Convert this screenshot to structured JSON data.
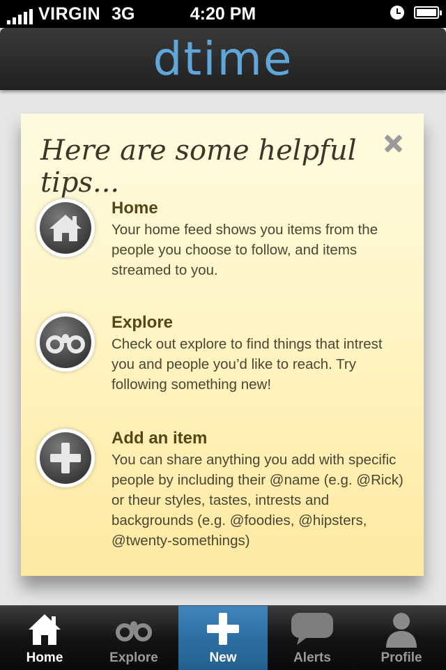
{
  "status_bar": {
    "carrier": "VIRGIN",
    "network": "3G",
    "time": "4:20 PM"
  },
  "nav": {
    "logo": "dtime"
  },
  "tips_card": {
    "title": "Here are some helpful tips...",
    "tips": [
      {
        "icon": "home-icon",
        "heading": "Home",
        "body": "Your home feed shows you items from the people you choose to follow, and items streamed to you."
      },
      {
        "icon": "binoculars-icon",
        "heading": "Explore",
        "body": "Check out explore to find things that intrest you and people you’d like to reach. Try following something new!"
      },
      {
        "icon": "plus-icon",
        "heading": "Add an item",
        "body": "You can share anything you add with specific people by including their @name (e.g. @Rick) or theur styles, tastes, intrests and backgrounds (e.g. @foodies, @hipsters, @twenty-somethings)"
      }
    ]
  },
  "tab_bar": {
    "items": [
      {
        "label": "Home",
        "icon": "home-icon",
        "selected": true
      },
      {
        "label": "Explore",
        "icon": "binoculars-icon"
      },
      {
        "label": "New",
        "icon": "plus-icon",
        "highlighted": true
      },
      {
        "label": "Alerts",
        "icon": "speech-bubble-icon"
      },
      {
        "label": "Profile",
        "icon": "person-icon"
      }
    ]
  },
  "colors": {
    "accent_blue": "#2d6fa3",
    "logo_blue": "#5fa7d9",
    "note_yellow": "#fff3bf"
  }
}
